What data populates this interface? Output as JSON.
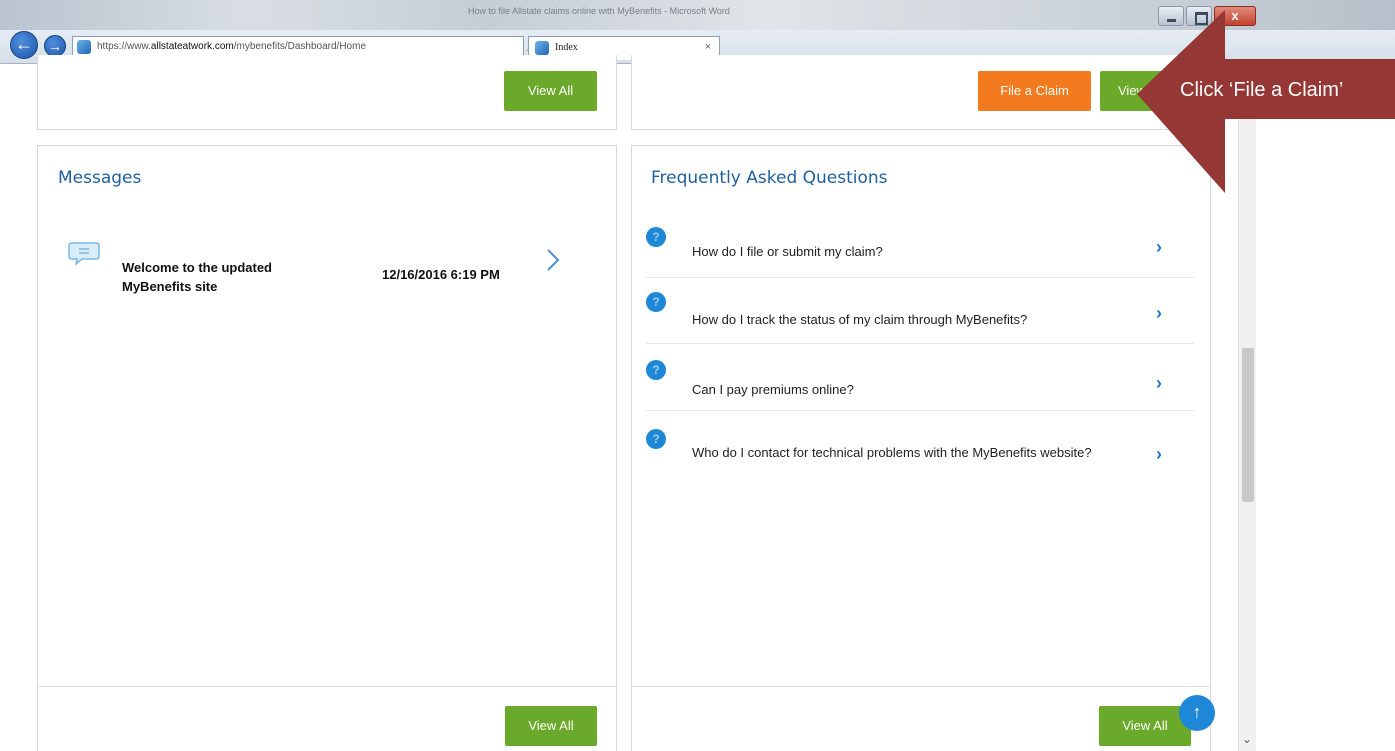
{
  "browser": {
    "window_title": "How to file Allstate claims online with MyBenefits - Microsoft Word",
    "close_label": "x",
    "url_prefix": "https://www.",
    "url_domain": "allstateatwork.com",
    "url_path": "/mybenefits/Dashboard/Home",
    "url_tools": "⌕ ▾ 🔒 ↻",
    "tab_label": "Index",
    "tab_close": "×",
    "gear_icon": "⚙"
  },
  "top_left_card": {
    "view_all_label": "View All"
  },
  "top_right_card": {
    "file_claim_label": "File a Claim",
    "view_all_label": "View All"
  },
  "messages": {
    "title": "Messages",
    "items": [
      {
        "title": "Welcome to the updated MyBenefits site",
        "timestamp": "12/16/2016 6:19 PM"
      }
    ],
    "view_all_label": "View All"
  },
  "faq": {
    "title": "Frequently Asked Questions",
    "question_icon": "?",
    "chevron": "›",
    "items": [
      {
        "question": "How do I file or submit my claim?"
      },
      {
        "question": "How do I track the status of my claim through MyBenefits?"
      },
      {
        "question": "Can I pay premiums online?"
      },
      {
        "question": "Who do I contact for technical problems with the MyBenefits website?"
      }
    ],
    "view_all_label": "View All"
  },
  "back_to_top_icon": "↑",
  "scroll_down_icon": "⌄",
  "annotation": {
    "text": "Click ‘File a Claim’"
  },
  "colors": {
    "green_button": "#6aa929",
    "orange_button": "#f47a1f",
    "title_blue": "#1f5f9f",
    "faq_icon_blue": "#1e88d6",
    "callout": "#953735"
  }
}
